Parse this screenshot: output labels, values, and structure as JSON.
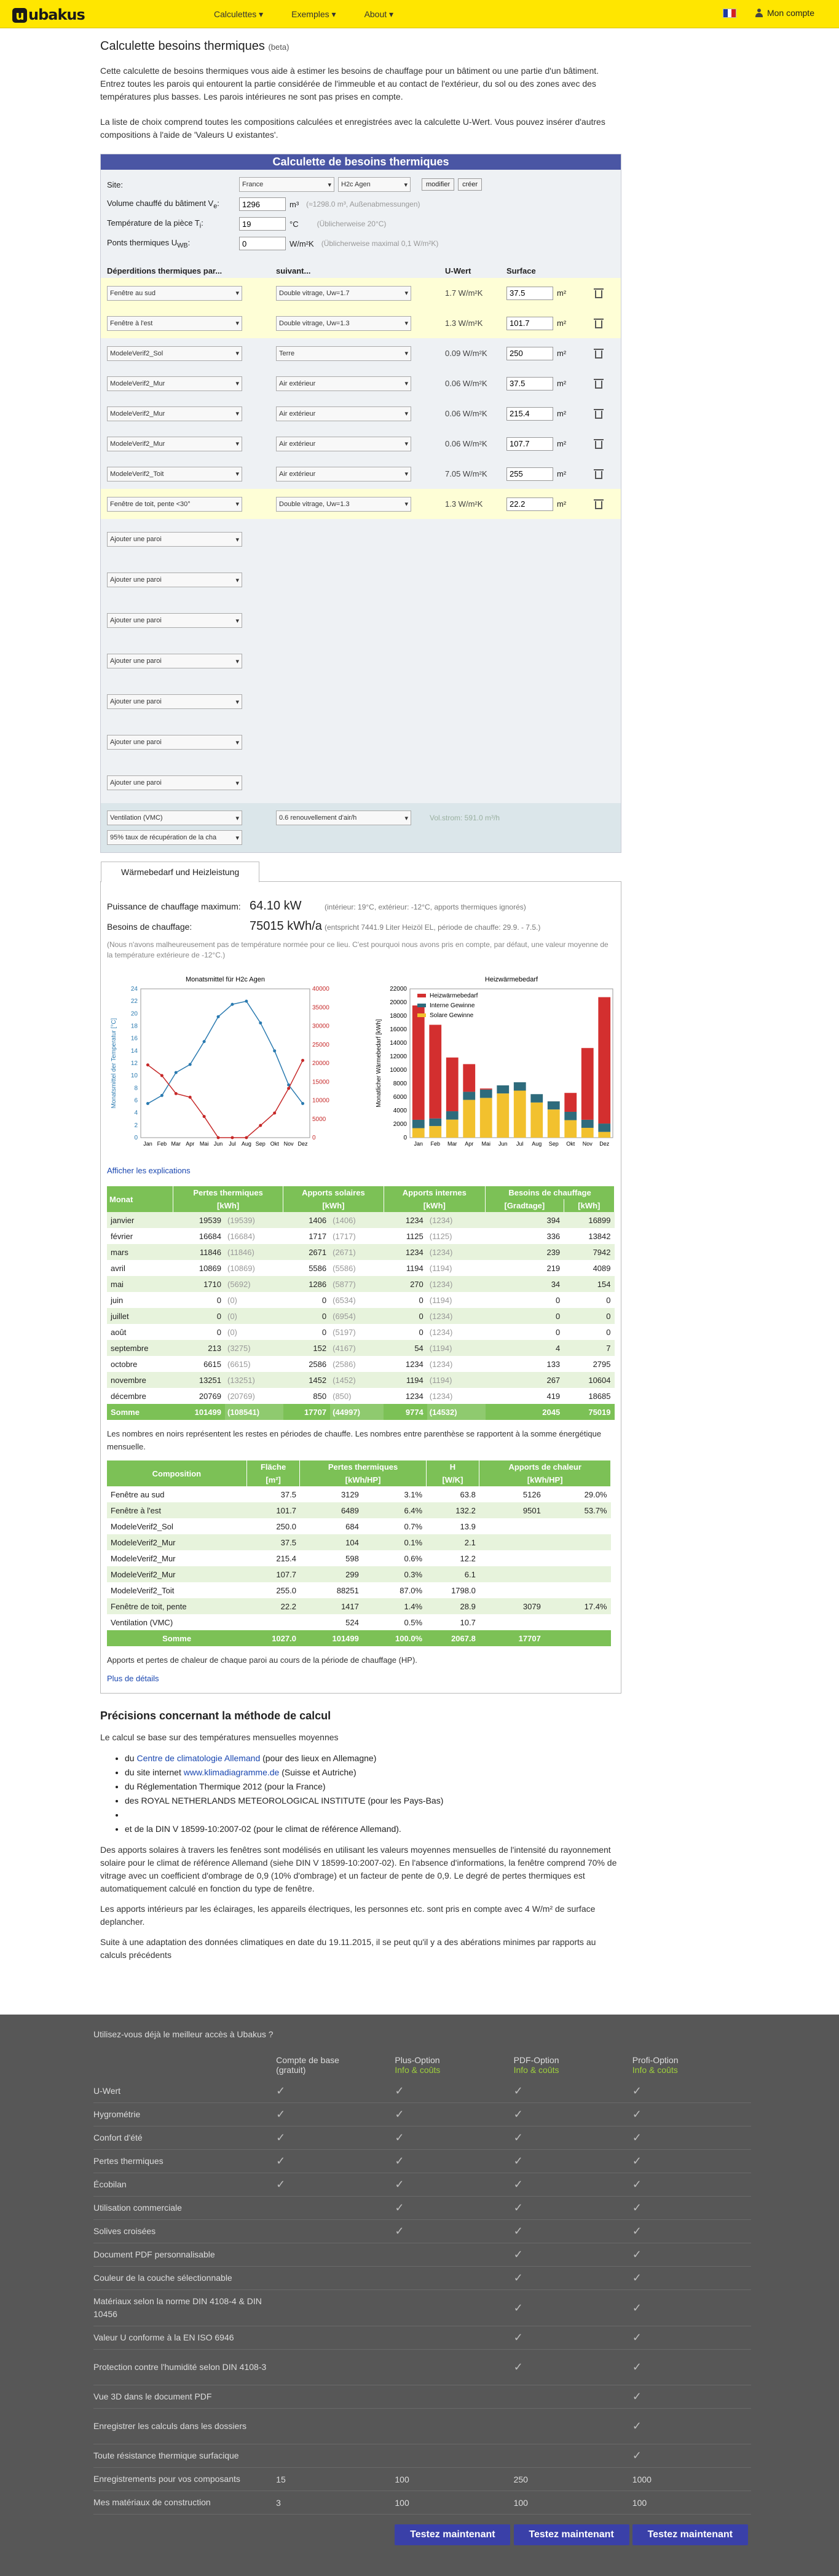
{
  "header": {
    "logo": "ubakus",
    "nav": [
      "Calculettes ▾",
      "Exemples ▾",
      "About ▾"
    ],
    "account": "Mon compte"
  },
  "title": "Calculette besoins thermiques",
  "title_beta": "(beta)",
  "intro": [
    "Cette calculette de besoins thermiques vous aide à estimer les besoins de chauffage pour un bâtiment ou une partie d'un bâtiment. Entrez toutes les parois qui entourent la partie considérée de l'immeuble et au contact de l'extérieur, du sol ou des zones avec des températures plus basses. Les parois intérieures ne sont pas prises en compte.",
    "La liste de choix comprend toutes les compositions calculées et enregistrées avec la calculette U-Wert. Vous pouvez insérer d'autres compositions à l'aide de 'Valeurs U existantes'."
  ],
  "calc": {
    "heading": "Calculette de besoins thermiques",
    "site_label": "Site:",
    "site_country": "France",
    "site_zone": "H2c Agen",
    "modify": "modifier",
    "create": "créer",
    "volume_label": "Volume chauffé du bâtiment V",
    "volume_sub": "e",
    "volume_value": "1296",
    "volume_unit": "m³",
    "volume_hint": "(≈1298.0 m³, Außenabmessungen)",
    "temp_label": "Température de la pièce T",
    "temp_sub": "i",
    "temp_value": "19",
    "temp_unit": "°C",
    "temp_hint": "(Üblicherweise 20°C)",
    "bridges_label": "Ponts thermiques U",
    "bridges_sub": "WB",
    "bridges_value": "0",
    "bridges_unit": "W/m²K",
    "bridges_hint": "(Üblicherweise maximal 0,1 W/m²K)",
    "col_losses": "Déperditions thermiques par...",
    "col_next": "suivant...",
    "col_u": "U-Wert",
    "col_surface": "Surface",
    "components": [
      {
        "name": "Fenêtre au sud",
        "next": "Double vitrage, Uw=1.7",
        "u": "1.7 W/m²K",
        "area": "37.5"
      },
      {
        "name": "Fenêtre à l'est",
        "next": "Double vitrage, Uw=1.3",
        "u": "1.3 W/m²K",
        "area": "101.7"
      },
      {
        "name": "ModeleVerif2_Sol",
        "next": "Terre",
        "u": "0.09 W/m²K",
        "area": "250"
      },
      {
        "name": "ModeleVerif2_Mur",
        "next": "Air extérieur",
        "u": "0.06 W/m²K",
        "area": "37.5"
      },
      {
        "name": "ModeleVerif2_Mur",
        "next": "Air extérieur",
        "u": "0.06 W/m²K",
        "area": "215.4"
      },
      {
        "name": "ModeleVerif2_Mur",
        "next": "Air extérieur",
        "u": "0.06 W/m²K",
        "area": "107.7"
      },
      {
        "name": "ModeleVerif2_Toit",
        "next": "Air extérieur",
        "u": "7.05 W/m²K",
        "area": "255"
      },
      {
        "name": "Fenêtre de toit, pente <30°",
        "next": "Double vitrage, Uw=1.3",
        "u": "1.3 W/m²K",
        "area": "22.2"
      }
    ],
    "add_label": "Ajouter une paroi",
    "area_unit": "m²",
    "vent_label": "Ventilation (VMC)",
    "vent_rate": "0.6 renouvellement d'air/h",
    "vent_hint": "Vol.strom: 591.0 m³/h",
    "recovery": "95% taux de récupération de la cha"
  },
  "results": {
    "tab": "Wärmebedarf und Heizleistung",
    "power_label": "Puissance de chauffage maximum:",
    "power_value": "64.10 kW",
    "power_note": "(intérieur: 19°C, extérieur: -12°C, apports thermiques ignorés)",
    "need_label": "Besoins de chauffage:",
    "need_value": "75015 kWh/a",
    "need_note": "(entspricht 7441.9 Liter Heizöl EL, période de chauffe: 29.9. - 7.5.)",
    "warn": "(Nous n'avons malheureusement pas de température normée pour ce lieu. C'est pourquoi nous avons pris en compte, par défaut, une valeur moyenne de la température extérieure de -12°C.)",
    "show_explain": "Afficher les explications",
    "table_headers": [
      "Monat",
      "Pertes thermiques",
      "Apports solaires",
      "Apports internes",
      "Besoins de chauffage"
    ],
    "table_units": [
      "",
      "[kWh]",
      "[kWh]",
      "[kWh]",
      "[Gradtage]",
      "[kWh]"
    ],
    "months": [
      [
        "janvier",
        "19539",
        "(19539)",
        "1406",
        "(1406)",
        "1234",
        "(1234)",
        "394",
        "16899"
      ],
      [
        "février",
        "16684",
        "(16684)",
        "1717",
        "(1717)",
        "1125",
        "(1125)",
        "336",
        "13842"
      ],
      [
        "mars",
        "11846",
        "(11846)",
        "2671",
        "(2671)",
        "1234",
        "(1234)",
        "239",
        "7942"
      ],
      [
        "avril",
        "10869",
        "(10869)",
        "5586",
        "(5586)",
        "1194",
        "(1194)",
        "219",
        "4089"
      ],
      [
        "mai",
        "1710",
        "(5692)",
        "1286",
        "(5877)",
        "270",
        "(1234)",
        "34",
        "154"
      ],
      [
        "juin",
        "0",
        "(0)",
        "0",
        "(6534)",
        "0",
        "(1194)",
        "0",
        "0"
      ],
      [
        "juillet",
        "0",
        "(0)",
        "0",
        "(6954)",
        "0",
        "(1234)",
        "0",
        "0"
      ],
      [
        "août",
        "0",
        "(0)",
        "0",
        "(5197)",
        "0",
        "(1234)",
        "0",
        "0"
      ],
      [
        "septembre",
        "213",
        "(3275)",
        "152",
        "(4167)",
        "54",
        "(1194)",
        "4",
        "7"
      ],
      [
        "octobre",
        "6615",
        "(6615)",
        "2586",
        "(2586)",
        "1234",
        "(1234)",
        "133",
        "2795"
      ],
      [
        "novembre",
        "13251",
        "(13251)",
        "1452",
        "(1452)",
        "1194",
        "(1194)",
        "267",
        "10604"
      ],
      [
        "décembre",
        "20769",
        "(20769)",
        "850",
        "(850)",
        "1234",
        "(1234)",
        "419",
        "18685"
      ]
    ],
    "sum": [
      "Somme",
      "101499",
      "(108541)",
      "17707",
      "(44997)",
      "9774",
      "(14532)",
      "2045",
      "75019"
    ],
    "table_note": "Les nombres en noirs représentent les restes en périodes de chauffe. Les nombres entre parenthèse se rapportent à la somme énergétique mensuelle.",
    "comp_headers": [
      "Composition",
      "Fläche",
      "Pertes thermiques",
      "H",
      "Apports de chaleur"
    ],
    "comp_units": [
      "",
      "[m²]",
      "[kWh/HP]",
      "",
      "[W/K]",
      "[kWh/HP]",
      ""
    ],
    "comp_rows": [
      [
        "Fenêtre au sud",
        "37.5",
        "3129",
        "3.1%",
        "63.8",
        "5126",
        "29.0%"
      ],
      [
        "Fenêtre à l'est",
        "101.7",
        "6489",
        "6.4%",
        "132.2",
        "9501",
        "53.7%"
      ],
      [
        "ModeleVerif2_Sol",
        "250.0",
        "684",
        "0.7%",
        "13.9",
        "",
        ""
      ],
      [
        "ModeleVerif2_Mur",
        "37.5",
        "104",
        "0.1%",
        "2.1",
        "",
        ""
      ],
      [
        "ModeleVerif2_Mur",
        "215.4",
        "598",
        "0.6%",
        "12.2",
        "",
        ""
      ],
      [
        "ModeleVerif2_Mur",
        "107.7",
        "299",
        "0.3%",
        "6.1",
        "",
        ""
      ],
      [
        "ModeleVerif2_Toit",
        "255.0",
        "88251",
        "87.0%",
        "1798.0",
        "",
        ""
      ],
      [
        "Fenêtre de toit, pente",
        "22.2",
        "1417",
        "1.4%",
        "28.9",
        "3079",
        "17.4%"
      ],
      [
        "Ventilation (VMC)",
        "",
        "524",
        "0.5%",
        "10.7",
        "",
        ""
      ]
    ],
    "comp_sum": [
      "Somme",
      "1027.0",
      "101499",
      "100.0%",
      "2067.8",
      "17707",
      ""
    ],
    "comp_note": "Apports et pertes de chaleur de chaque paroi au cours de la période de chauffage (HP).",
    "more": "Plus de détails"
  },
  "chart_data": [
    {
      "type": "line",
      "title": "Monatsmittel für H2c Agen",
      "categories": [
        "Jan",
        "Feb",
        "Mar",
        "Apr",
        "Mai",
        "Jun",
        "Jul",
        "Aug",
        "Sep",
        "Okt",
        "Nov",
        "Dez"
      ],
      "ylabel": "Monatsmittel der Temperatur [°C]",
      "ylabel_right": "",
      "ylim": [
        0,
        24
      ],
      "ylim_right": [
        0,
        40000
      ],
      "y_ticks_left": [
        "0",
        "2",
        "4",
        "6",
        "8",
        "10",
        "12",
        "14",
        "16",
        "18",
        "20",
        "22",
        "24"
      ],
      "y_ticks_right": [
        "0",
        "5000",
        "10000",
        "15000",
        "20000",
        "25000",
        "30000",
        "35000",
        "40000"
      ],
      "series": [
        {
          "color": "#2a7ab0",
          "values": [
            5.5,
            6.8,
            10.5,
            11.8,
            15.5,
            19.5,
            21.5,
            22.0,
            18.5,
            14.0,
            8.5,
            5.5
          ]
        },
        {
          "color": "#c62828",
          "values": [
            19539,
            16684,
            11846,
            10869,
            5692,
            0,
            0,
            0,
            3275,
            6615,
            13251,
            20769
          ]
        }
      ]
    },
    {
      "type": "bar",
      "title": "Heizwärmebedarf",
      "categories": [
        "Jan",
        "Feb",
        "Mar",
        "Apr",
        "Mai",
        "Jun",
        "Jul",
        "Aug",
        "Sep",
        "Okt",
        "Nov",
        "Dez"
      ],
      "ylabel": "Monatlicher Wärmebedarf [kWh]",
      "ylim": [
        0,
        22000
      ],
      "y_ticks": [
        "0",
        "2000",
        "4000",
        "6000",
        "8000",
        "10000",
        "12000",
        "14000",
        "16000",
        "18000",
        "20000",
        "22000"
      ],
      "series": [
        {
          "name": "Heizwärmebedarf",
          "color": "#d32f2f",
          "values": [
            16899,
            13842,
            7942,
            4089,
            154,
            0,
            0,
            0,
            7,
            2795,
            10604,
            18685
          ]
        },
        {
          "name": "Interne Gewinne",
          "color": "#2e6b7c",
          "values": [
            1234,
            1125,
            1234,
            1194,
            1234,
            1194,
            1234,
            1234,
            1194,
            1234,
            1194,
            1234
          ]
        },
        {
          "name": "Solare Gewinne",
          "color": "#f2c12e",
          "values": [
            1406,
            1717,
            2671,
            5586,
            5877,
            6534,
            6954,
            5197,
            4167,
            2586,
            1452,
            850
          ]
        }
      ]
    }
  ],
  "method": {
    "heading": "Précisions concernant la méthode de calcul",
    "lead": "Le calcul se base sur des températures mensuelles moyennes",
    "sources": [
      {
        "pre": "du ",
        "link": "Centre de climatologie Allemand",
        "post": " (pour des lieux en Allemagne)"
      },
      {
        "pre": "du site internet ",
        "link": "www.klimadiagramme.de",
        "post": " (Suisse et Autriche)"
      },
      {
        "pre": "du Réglementation Thermique 2012 (pour la France)",
        "link": "",
        "post": ""
      },
      {
        "pre": "des ROYAL NETHERLANDS METEOROLOGICAL INSTITUTE (pour les Pays-Bas)",
        "link": "",
        "post": ""
      },
      {
        "pre": "",
        "link": "",
        "post": ""
      },
      {
        "pre": "et de la DIN V 18599-10:2007-02 (pour le climat de référence Allemand).",
        "link": "",
        "post": ""
      }
    ],
    "p1": "Des apports solaires à travers les fenêtres sont modélisés en utilisant les valeurs moyennes mensuelles de l'intensité du rayonnement solaire pour le climat de référence Allemand (siehe DIN V 18599-10:2007-02). En l'absence d'informations, la fenêtre comprend 70% de vitrage avec un coefficient d'ombrage de 0,9 (10% d'ombrage) et un facteur de pente de 0,9. Le degré de pertes thermiques est automatiquement calculé en fonction du type de fenêtre.",
    "p2": "Les apports intérieurs par les éclairages, les appareils électriques, les personnes etc. sont pris en compte avec 4 W/m² de surface deplancher.",
    "p3": " Suite à une adaptation des données climatiques en date du 19.11.2015, il se peut qu'il y a des abérations minimes par rapports au calculs précédents"
  },
  "footer": {
    "question": "Utilisez-vous déjà le meilleur accès à Ubakus ?",
    "cols": [
      {
        "title": "Compte de base",
        "sub": "(gratuit)"
      },
      {
        "title": "Plus-Option",
        "sub": "Info & coûts"
      },
      {
        "title": "PDF-Option",
        "sub": "Info & coûts"
      },
      {
        "title": "Profi-Option",
        "sub": "Info & coûts"
      }
    ],
    "features": [
      {
        "name": "U-Wert",
        "v": [
          "✓",
          "✓",
          "✓",
          "✓"
        ]
      },
      {
        "name": "Hygrométrie",
        "v": [
          "✓",
          "✓",
          "✓",
          "✓"
        ]
      },
      {
        "name": "Confort d'été",
        "v": [
          "✓",
          "✓",
          "✓",
          "✓"
        ]
      },
      {
        "name": "Pertes thermiques",
        "v": [
          "✓",
          "✓",
          "✓",
          "✓"
        ]
      },
      {
        "name": "Écobilan",
        "v": [
          "✓",
          "✓",
          "✓",
          "✓"
        ]
      },
      {
        "name": "Utilisation commerciale",
        "v": [
          "",
          "✓",
          "✓",
          "✓"
        ]
      },
      {
        "name": "Solives croisées",
        "v": [
          "",
          "✓",
          "✓",
          "✓"
        ]
      },
      {
        "name": "Document PDF personnalisable",
        "v": [
          "",
          "",
          "✓",
          "✓"
        ]
      },
      {
        "name": "Couleur de la couche sélectionnable",
        "v": [
          "",
          "",
          "✓",
          "✓"
        ]
      },
      {
        "name": "Matériaux selon la norme DIN 4108-4 & DIN 10456",
        "v": [
          "",
          "",
          "✓",
          "✓"
        ]
      },
      {
        "name": "Valeur U conforme à la EN ISO 6946",
        "v": [
          "",
          "",
          "✓",
          "✓"
        ]
      },
      {
        "name": "Protection contre l'humidité selon DIN 4108-3",
        "v": [
          "",
          "",
          "✓",
          "✓"
        ]
      },
      {
        "name": "Vue 3D dans le document PDF",
        "v": [
          "",
          "",
          "",
          "✓"
        ]
      },
      {
        "name": "Enregistrer les calculs dans les dossiers",
        "v": [
          "",
          "",
          "",
          "✓"
        ]
      },
      {
        "name": "Toute résistance thermique surfacique",
        "v": [
          "",
          "",
          "",
          "✓"
        ]
      },
      {
        "name": "Enregistrements pour vos composants",
        "v": [
          "15",
          "100",
          "250",
          "1000"
        ]
      },
      {
        "name": "Mes matériaux de construction",
        "v": [
          "3",
          "100",
          "100",
          "100"
        ]
      }
    ],
    "cta": "Testez maintenant"
  }
}
